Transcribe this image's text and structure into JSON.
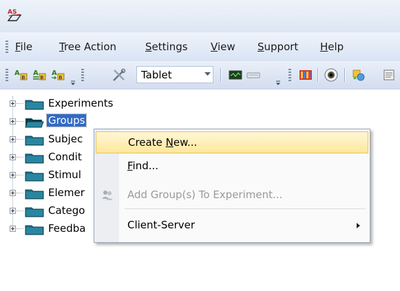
{
  "menubar": {
    "items": [
      {
        "label": "File",
        "underline": "F",
        "rest": "ile"
      },
      {
        "label": "Tree Action",
        "underline": "T",
        "rest": "ree Action"
      },
      {
        "label": "Settings",
        "underline": "S",
        "rest": "ettings"
      },
      {
        "label": "View",
        "underline": "V",
        "rest": "iew"
      },
      {
        "label": "Support",
        "underline": "S",
        "rest": "upport"
      },
      {
        "label": "Help",
        "underline": "H",
        "rest": "elp"
      }
    ]
  },
  "toolbar": {
    "combo_value": "Tablet"
  },
  "tree": {
    "items": [
      {
        "label": "Experiments"
      },
      {
        "label": "Groups"
      },
      {
        "label": "Subjec"
      },
      {
        "label": "Condit"
      },
      {
        "label": "Stimul"
      },
      {
        "label": "Elemer"
      },
      {
        "label": "Catego"
      },
      {
        "label": "Feedba"
      }
    ]
  },
  "context_menu": {
    "items": [
      {
        "pre": "Create ",
        "underline": "N",
        "post": "ew..."
      },
      {
        "pre": "",
        "underline": "F",
        "post": "ind..."
      },
      {
        "pre": "Add Group(s) To Experiment...",
        "underline": "",
        "post": ""
      },
      {
        "pre": "Client-Server",
        "underline": "",
        "post": ""
      }
    ]
  },
  "colors": {
    "selection": "#316ac5",
    "highlight": "#ffe89a",
    "folder": "#1f6f86"
  }
}
